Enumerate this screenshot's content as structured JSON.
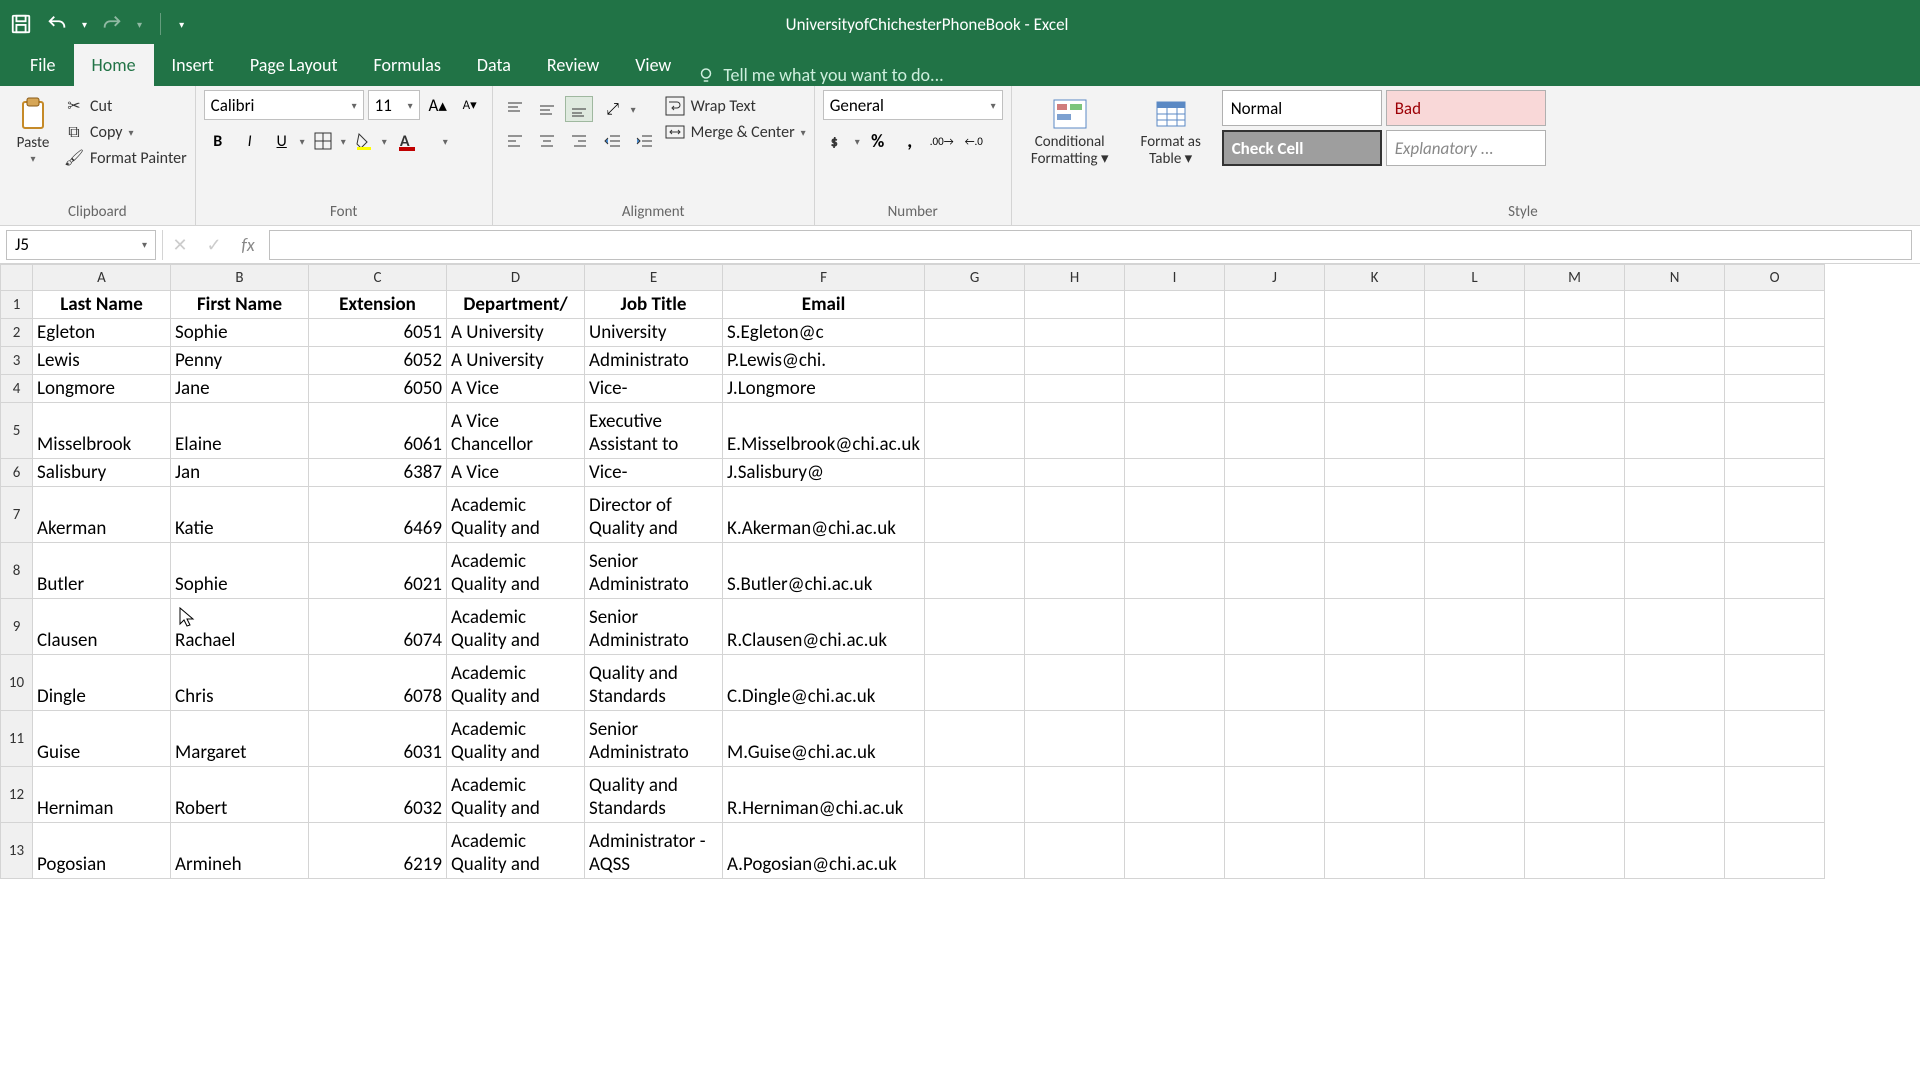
{
  "titlebar": {
    "document_title": "UniversityofChichesterPhoneBook - Excel"
  },
  "tabs": {
    "file": "File",
    "home": "Home",
    "insert": "Insert",
    "page_layout": "Page Layout",
    "formulas": "Formulas",
    "data": "Data",
    "review": "Review",
    "view": "View",
    "tellme": "Tell me what you want to do..."
  },
  "ribbon": {
    "clipboard": {
      "paste": "Paste",
      "cut": "Cut",
      "copy": "Copy",
      "format_painter": "Format Painter",
      "group_label": "Clipboard"
    },
    "font": {
      "font_name": "Calibri",
      "font_size": "11",
      "group_label": "Font"
    },
    "alignment": {
      "wrap_text": "Wrap Text",
      "merge_center": "Merge & Center",
      "group_label": "Alignment"
    },
    "number": {
      "format": "General",
      "group_label": "Number"
    },
    "styles": {
      "conditional": "Conditional Formatting",
      "format_table": "Format as Table",
      "normal": "Normal",
      "bad": "Bad",
      "check_cell": "Check Cell",
      "explanatory": "Explanatory ...",
      "group_label": "Style"
    }
  },
  "formula_bar": {
    "name_box": "J5",
    "formula": ""
  },
  "chart_data": {
    "type": "table",
    "columns": [
      "A",
      "B",
      "C",
      "D",
      "E",
      "F",
      "G",
      "H",
      "I",
      "J",
      "K",
      "L",
      "M",
      "N",
      "O"
    ],
    "headers": [
      "Last Name",
      "First Name",
      "Extension",
      "Department/",
      "Job Title",
      "Email"
    ],
    "rows": [
      {
        "r": "2",
        "last": "Egleton",
        "first": "Sophie",
        "ext": "6051",
        "dept": "A University",
        "job": "University",
        "email": "S.Egleton@c"
      },
      {
        "r": "3",
        "last": "Lewis",
        "first": "Penny",
        "ext": "6052",
        "dept": "A University",
        "job": "Administrato",
        "email": "P.Lewis@chi."
      },
      {
        "r": "4",
        "last": "Longmore",
        "first": "Jane",
        "ext": "6050",
        "dept": "A Vice",
        "job": "Vice-",
        "email": "J.Longmore"
      },
      {
        "r": "5",
        "last": "Misselbrook",
        "first": "Elaine",
        "ext": "6061",
        "dept": "A Vice Chancellor",
        "job": "Executive Assistant to",
        "email": "E.Misselbrook@chi.ac.uk"
      },
      {
        "r": "6",
        "last": "Salisbury",
        "first": "Jan",
        "ext": "6387",
        "dept": "A Vice",
        "job": "Vice-",
        "email": "J.Salisbury@"
      },
      {
        "r": "7",
        "last": "Akerman",
        "first": "Katie",
        "ext": "6469",
        "dept": "Academic Quality and",
        "job": "Director of Quality and",
        "email": "K.Akerman@chi.ac.uk"
      },
      {
        "r": "8",
        "last": "Butler",
        "first": "Sophie",
        "ext": "6021",
        "dept": "Academic Quality and",
        "job": "Senior Administrato",
        "email": "S.Butler@chi.ac.uk"
      },
      {
        "r": "9",
        "last": "Clausen",
        "first": "Rachael",
        "ext": "6074",
        "dept": "Academic Quality and",
        "job": "Senior Administrato",
        "email": "R.Clausen@chi.ac.uk"
      },
      {
        "r": "10",
        "last": "Dingle",
        "first": "Chris",
        "ext": "6078",
        "dept": "Academic Quality and",
        "job": "Quality and Standards",
        "email": "C.Dingle@chi.ac.uk"
      },
      {
        "r": "11",
        "last": "Guise",
        "first": "Margaret",
        "ext": "6031",
        "dept": "Academic Quality and",
        "job": "Senior Administrato",
        "email": "M.Guise@chi.ac.uk"
      },
      {
        "r": "12",
        "last": "Herniman",
        "first": "Robert",
        "ext": "6032",
        "dept": "Academic Quality and",
        "job": "Quality and Standards",
        "email": "R.Herniman@chi.ac.uk"
      },
      {
        "r": "13",
        "last": "Pogosian",
        "first": "Armineh",
        "ext": "6219",
        "dept": "Academic Quality and",
        "job": "Administrator - AQSS",
        "email": "A.Pogosian@chi.ac.uk"
      }
    ]
  }
}
